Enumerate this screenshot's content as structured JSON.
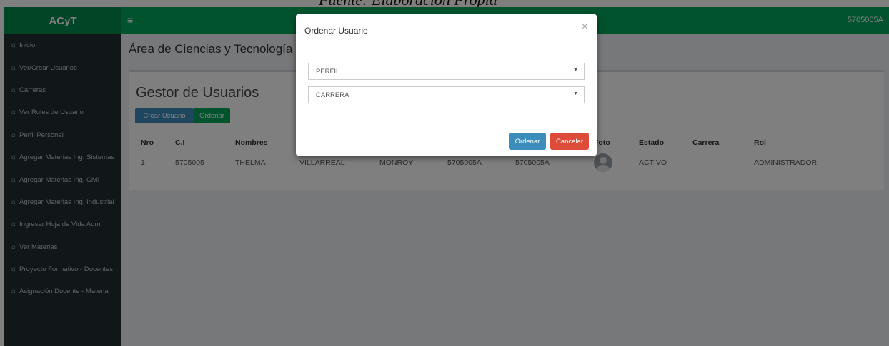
{
  "caption": "Fuente: Elaboración Propia",
  "header": {
    "brand": "ACyT",
    "menu_icon": "hamburger-icon",
    "user_id": "5705005A"
  },
  "sidebar": {
    "items": [
      {
        "label": "Inicio"
      },
      {
        "label": "Ver/Crear Usuarios"
      },
      {
        "label": "Carreras"
      },
      {
        "label": "Ver Roles de Usuario"
      },
      {
        "label": "Perfil Personal"
      },
      {
        "label": "Agregar Materias Ing. Sistemas"
      },
      {
        "label": "Agregar Materias Ing. Civil"
      },
      {
        "label": "Agregar Materias Ing. Industrial"
      },
      {
        "label": "Ingresar Hoja de Vida Adm"
      },
      {
        "label": "Ver Materias"
      },
      {
        "label": "Proyecto Formativo - Docentes"
      },
      {
        "label": "Asignación Docente - Materia"
      }
    ],
    "item_icon": "home-icon"
  },
  "main": {
    "page_title": "Área de Ciencias y Tecnología",
    "box_title": "Gestor de Usuarios",
    "create_button": "Crear Usuario",
    "order_button": "Ordenar",
    "table": {
      "headers": [
        "Nro",
        "C.I",
        "Nombres",
        "",
        "",
        "",
        "",
        "Foto",
        "Estado",
        "Carrera",
        "Rol"
      ],
      "rows": [
        {
          "nro": "1",
          "ci": "5705005",
          "nombres": "THELMA",
          "paterno": "VILLARREAL",
          "materno": "MONROY",
          "col6": "5705005A",
          "col7": "5705005A",
          "estado": "ACTIVO",
          "carrera": "",
          "rol": "ADMINISTRADOR"
        }
      ]
    }
  },
  "modal": {
    "title": "Ordenar Usuario",
    "close": "×",
    "select_perfil": "PERFIL",
    "select_carrera": "CARRERA",
    "arrow": "▼",
    "ok_button": "Ordenar",
    "cancel_button": "Cancelar"
  }
}
